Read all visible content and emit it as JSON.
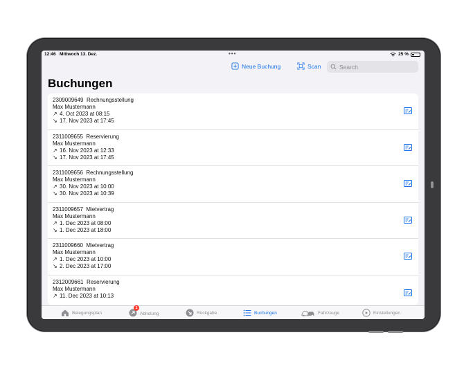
{
  "status": {
    "time": "12:46",
    "date": "Mittwoch 13. Dez.",
    "battery": "25 %"
  },
  "toolbar": {
    "new_booking": "Neue Buchung",
    "scan": "Scan",
    "search_placeholder": "Search"
  },
  "page_title": "Buchungen",
  "bookings": [
    {
      "number": "2309009649",
      "type": "Rechnungsstellung",
      "name": "Max Mustermann",
      "pickup": "4. Oct 2023 at 08:15",
      "return": "17. Nov 2023 at 17:45"
    },
    {
      "number": "2311009655",
      "type": "Reservierung",
      "name": "Max Mustermann",
      "pickup": "16. Nov 2023 at 12:33",
      "return": "17. Nov 2023 at 17:45"
    },
    {
      "number": "2311009656",
      "type": "Rechnungsstellung",
      "name": "Max Mustermann",
      "pickup": "30. Nov 2023 at 10:00",
      "return": "30. Nov 2023 at 10:39"
    },
    {
      "number": "2311009657",
      "type": "Mietvertrag",
      "name": "Max Mustermann",
      "pickup": "1. Dec 2023 at 08:00",
      "return": "1. Dec 2023 at 18:00"
    },
    {
      "number": "2311009660",
      "type": "Mietvertrag",
      "name": "Max Mustermann",
      "pickup": "1. Dec 2023 at 10:00",
      "return": "2. Dec 2023 at 17:00"
    },
    {
      "number": "2312009661",
      "type": "Reservierung",
      "name": "Max Mustermann",
      "pickup": "11. Dec 2023 at 10:13",
      "return": ""
    }
  ],
  "tabs": {
    "belegungsplan": "Belegungsplan",
    "abholung": "Abholung",
    "abholung_badge": "1",
    "rueckgabe": "Rückgabe",
    "buchungen": "Buchungen",
    "fahrzeuge": "Fahrzeuge",
    "einstellungen": "Einstellungen"
  },
  "colors": {
    "accent": "#1a73e8",
    "badge": "#ff3b30"
  },
  "icons": {
    "pickup": "↗",
    "return": "↘"
  }
}
